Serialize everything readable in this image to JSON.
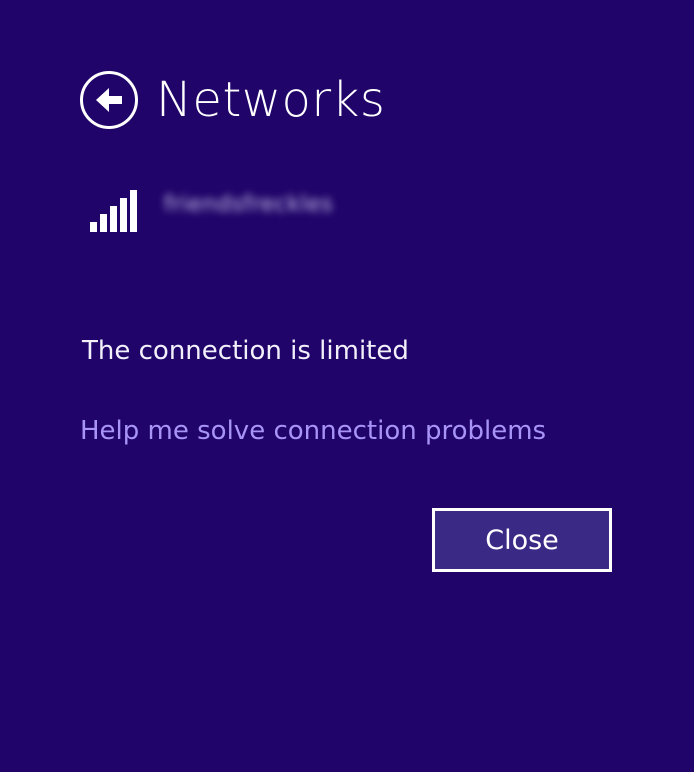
{
  "panel": {
    "title": "Networks",
    "back_icon": "back-arrow-icon"
  },
  "network": {
    "signal_icon": "wifi-signal-icon",
    "signal_bars": 5,
    "name": "friendsfreckles"
  },
  "status": {
    "text": "The connection is limited"
  },
  "help": {
    "link_text": "Help me solve connection problems"
  },
  "actions": {
    "close_label": "Close"
  },
  "colors": {
    "background": "#200469",
    "link": "#a894f4",
    "text": "#ffffff"
  }
}
